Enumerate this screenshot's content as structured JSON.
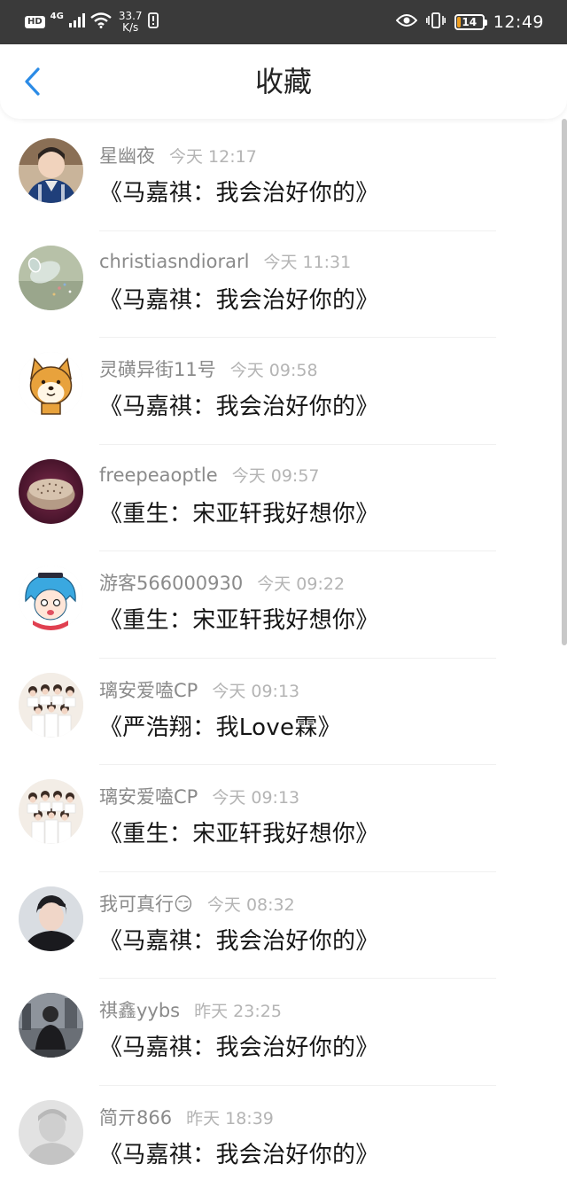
{
  "status_bar": {
    "hd": "HD",
    "network": "4G",
    "speed_value": "33.7",
    "speed_unit": "K/s",
    "battery": "14",
    "battery_level": 0.14,
    "time": "12:49"
  },
  "header": {
    "title": "收藏"
  },
  "favorites": [
    {
      "user": "星幽夜",
      "time": "今天 12:17",
      "title": "《马嘉祺：我会治好你的》",
      "avatar": "portrait-blue-jacket-avatar"
    },
    {
      "user": "christiasndiorarl",
      "time": "今天 11:31",
      "title": "《马嘉祺：我会治好你的》",
      "avatar": "glass-jar-avatar"
    },
    {
      "user": "灵磺异街11号",
      "time": "今天 09:58",
      "title": "《马嘉祺：我会治好你的》",
      "avatar": "shiba-dog-avatar"
    },
    {
      "user": "freepeaoptle",
      "time": "今天 09:57",
      "title": "《重生：宋亚轩我好想你》",
      "avatar": "sea-urchin-avatar"
    },
    {
      "user": "游客566000930",
      "time": "今天 09:22",
      "title": "《重生：宋亚轩我好想你》",
      "avatar": "anime-blue-hair-avatar"
    },
    {
      "user": "璃安爱嗑CP",
      "time": "今天 09:13",
      "title": "《严浩翔：我Love霖》",
      "avatar": "group-photo-avatar"
    },
    {
      "user": "璃安爱嗑CP",
      "time": "今天 09:13",
      "title": "《重生：宋亚轩我好想你》",
      "avatar": "group-photo-avatar"
    },
    {
      "user": "我可真行😏",
      "time": "今天 08:32",
      "title": "《马嘉祺：我会治好你的》",
      "avatar": "portrait-dark-avatar"
    },
    {
      "user": "祺鑫yybs",
      "time": "昨天 23:25",
      "title": "《马嘉祺：我会治好你的》",
      "avatar": "street-photo-avatar"
    },
    {
      "user": "简亓866",
      "time": "昨天 18:39",
      "title": "《马嘉祺：我会治好你的》",
      "avatar": "faded-portrait-avatar"
    }
  ],
  "colors": {
    "status_bar_bg": "#3a3a3a",
    "back_arrow": "#2b8be6",
    "username": "#8a8a8a",
    "time": "#b4b4b4",
    "title_text": "#151515"
  }
}
